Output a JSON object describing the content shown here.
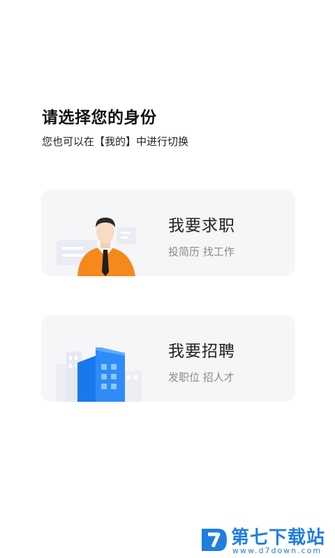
{
  "header": {
    "title": "请选择您的身份",
    "subtitle": "您也可以在【我的】中进行切换"
  },
  "options": [
    {
      "title": "我要求职",
      "description": "投简历 找工作",
      "illustration": "job-seeker-person-icon"
    },
    {
      "title": "我要招聘",
      "description": "发职位 招人才",
      "illustration": "office-building-icon"
    }
  ],
  "watermark": {
    "brand": "第七下载站",
    "url": "www.d7down.com"
  },
  "colors": {
    "card_bg": "#f6f6f8",
    "accent_orange": "#f5891d",
    "accent_blue": "#2f8cf7",
    "watermark_blue": "#1f7fe0"
  }
}
